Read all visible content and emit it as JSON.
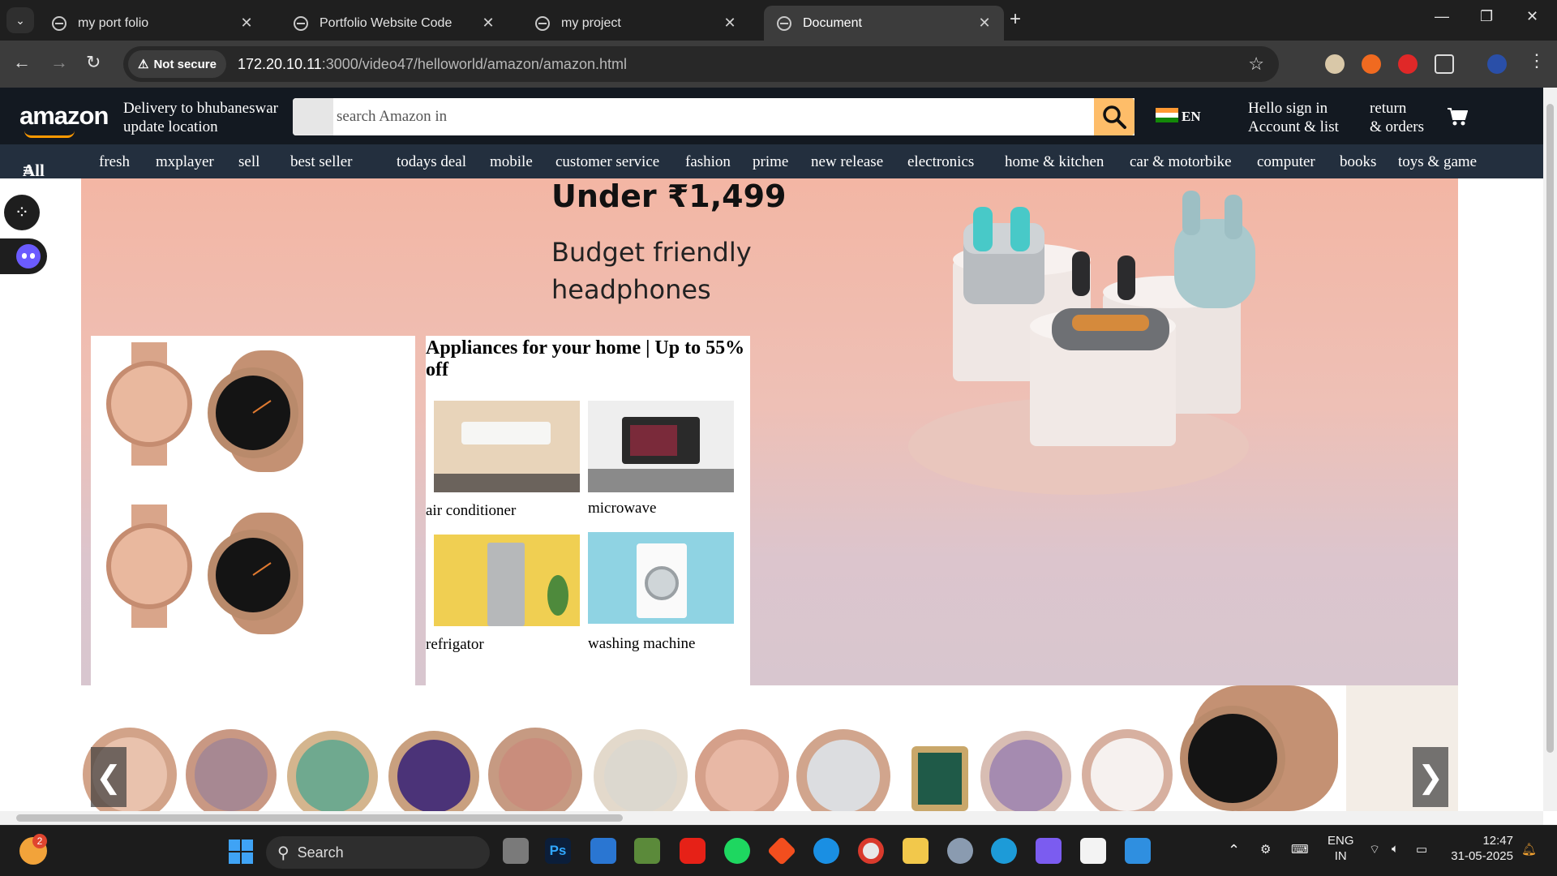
{
  "browser": {
    "tabs": [
      {
        "title": "my port folio",
        "active": false
      },
      {
        "title": "Portfolio Website Code",
        "active": false
      },
      {
        "title": "my project",
        "active": false
      },
      {
        "title": "Document",
        "active": true
      }
    ],
    "security_label": "Not secure",
    "url_host": "172.20.10.11",
    "url_rest": ":3000/video47/helloworld/amazon/amazon.html"
  },
  "header": {
    "logo": "amazon",
    "delivery_line1": "Delivery to bhubaneswar",
    "delivery_line2": "update location",
    "search_placeholder": "search Amazon in",
    "lang": "EN",
    "account_line1": "Hello sign in",
    "account_line2": "Account & list",
    "returns_line1": "return",
    "returns_line2": "& orders"
  },
  "nav": {
    "all": "All",
    "items": [
      "fresh",
      "mxplayer",
      "sell",
      "best seller",
      "todays deal",
      "mobile",
      "customer service",
      "fashion",
      "prime",
      "new release",
      "electronics",
      "home & kitchen",
      "car & motorbike",
      "computer",
      "books",
      "toys & game"
    ]
  },
  "hero": {
    "headline": "Under ₹1,499",
    "sub_line1": "Budget friendly",
    "sub_line2": "headphones"
  },
  "appliances_card": {
    "title": "Appliances for your home | Up to 55% off",
    "items": [
      {
        "caption": "air conditioner"
      },
      {
        "caption": "microwave"
      },
      {
        "caption": "refrigator"
      },
      {
        "caption": "washing machine"
      }
    ]
  },
  "carousel": {
    "prev": "❮",
    "next": "❯"
  },
  "taskbar": {
    "search_label": "Search",
    "notification_count": "2",
    "lang_line1": "ENG",
    "lang_line2": "IN",
    "time": "12:47",
    "date": "31-05-2025"
  },
  "colors": {
    "amazon_dark": "#131921",
    "amazon_nav": "#232f3e",
    "search_button": "#febd69",
    "brand_orange": "#ff9900"
  }
}
